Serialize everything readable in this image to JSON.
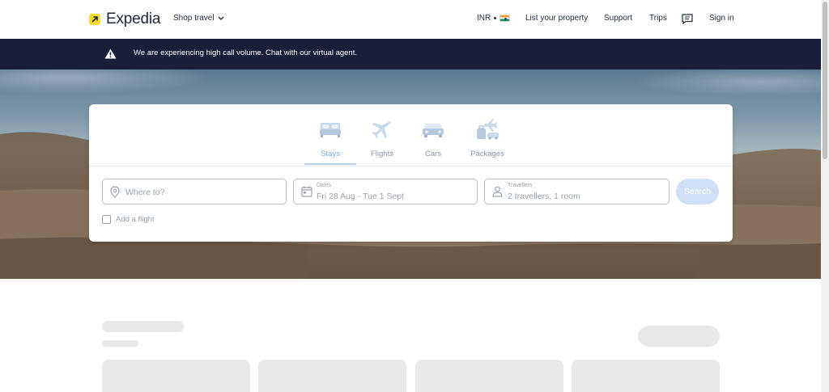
{
  "header": {
    "brand": "Expedia",
    "shop_travel": "Shop travel",
    "currency": "INR",
    "list_property": "List your property",
    "support": "Support",
    "trips": "Trips",
    "sign_in": "Sign in",
    "icons": [
      "expedia-logo-icon",
      "chevron-down-icon",
      "india-flag-icon",
      "chat-icon"
    ]
  },
  "alert": {
    "message": "We are experiencing high call volume. Chat with our virtual agent.",
    "icon": "warning-icon"
  },
  "search": {
    "tabs": [
      {
        "label": "Stays",
        "icon": "bed-icon",
        "active": true
      },
      {
        "label": "Flights",
        "icon": "plane-icon",
        "active": false
      },
      {
        "label": "Cars",
        "icon": "car-icon",
        "active": false
      },
      {
        "label": "Packages",
        "icon": "packages-icon",
        "active": false
      }
    ],
    "destination_placeholder": "Where to?",
    "dates_label": "Dates",
    "dates_value": "Fri 28 Aug - Tue 1 Sept",
    "travellers_label": "Travellers",
    "travellers_value": "2 travellers, 1 room",
    "search_button": "Search",
    "add_flight": "Add a flight"
  },
  "colors": {
    "brand_yellow": "#fddb32",
    "alert_bg": "#191e3b",
    "active_tab": "#7eaadd",
    "search_button": "#cfdff6"
  }
}
